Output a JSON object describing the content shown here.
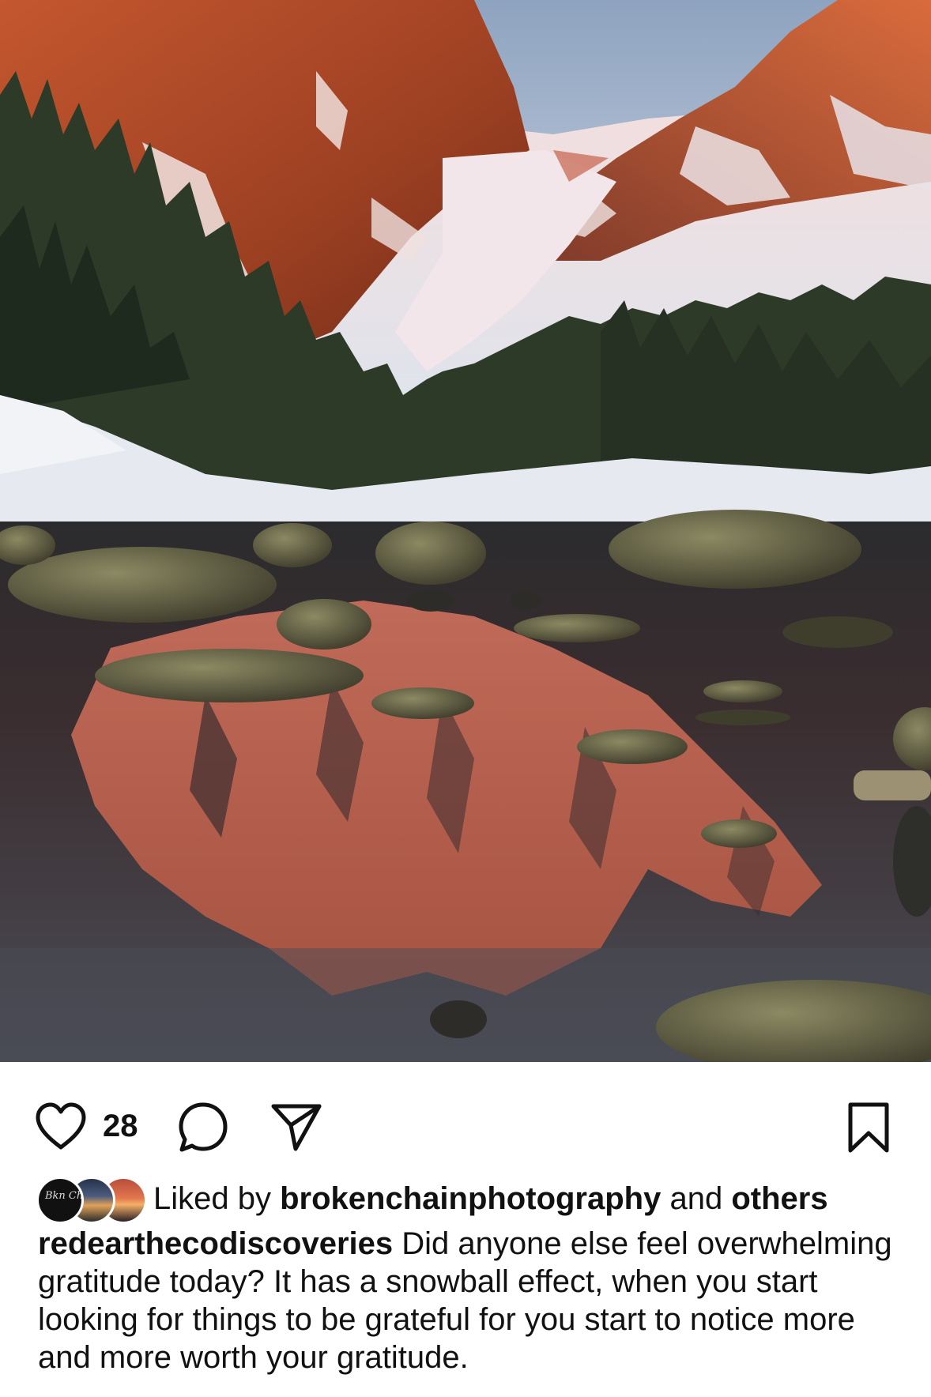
{
  "post": {
    "image_alt": "Alpenglow on snowy peaks reflected in a mountain lake",
    "like_count": "28",
    "liked_by_prefix": "Liked by",
    "liked_by_user": "brokenchainphotography",
    "liked_by_connector": "and",
    "liked_by_suffix": "others",
    "author": "redearthecodiscoveries",
    "caption_text": "Did anyone else feel overwhelming gratitude today? It has a snowball effect, when you start looking for things to be grateful for you start to notice more and more worth your gratitude."
  },
  "icons": {
    "like": "heart-icon",
    "comment": "comment-bubble-icon",
    "share": "paper-plane-icon",
    "save": "bookmark-icon"
  },
  "colors": {
    "text": "#111111",
    "background": "#ffffff"
  }
}
